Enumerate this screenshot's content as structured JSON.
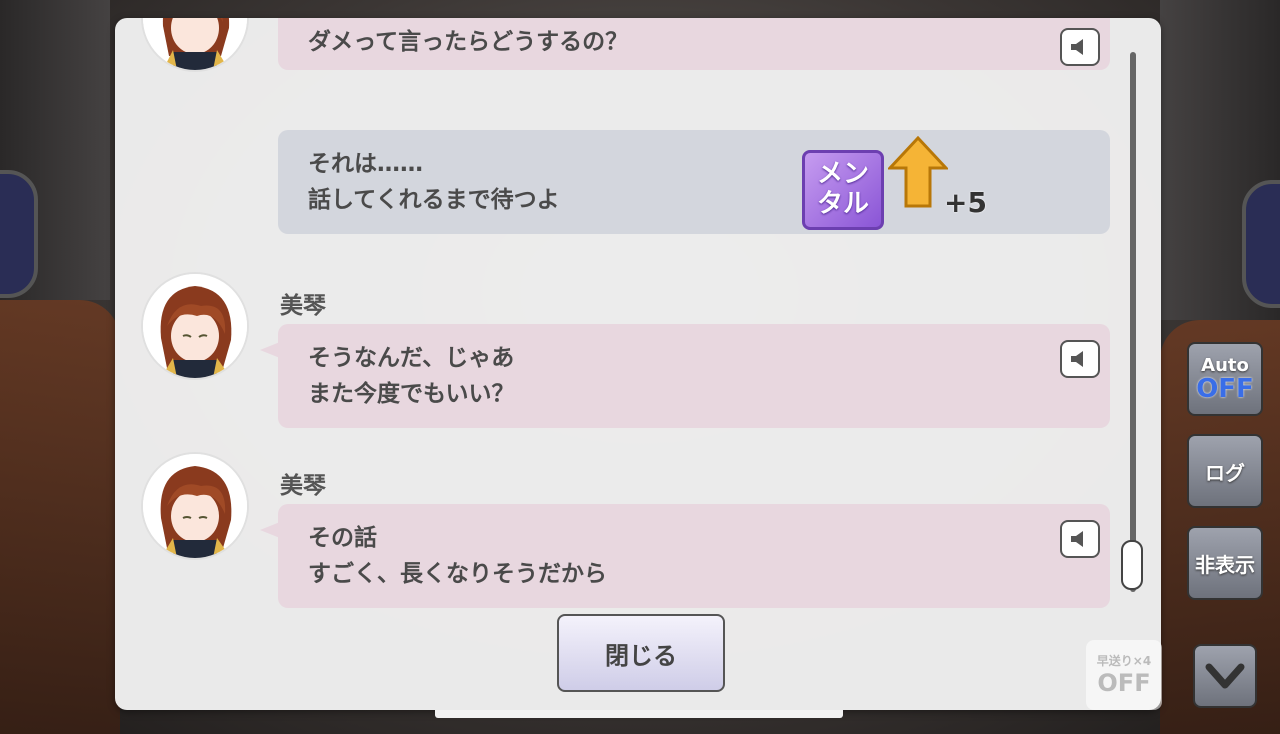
{
  "log": {
    "entries": [
      {
        "speaker": "",
        "text": "ダメって言ったらどうするの？"
      },
      {
        "choice_line1": "それは……",
        "choice_line2": "話してくれるまで待つよ"
      },
      {
        "speaker": "美琴",
        "line1": "そうなんだ、じゃあ",
        "line2": "また今度でもいい？"
      },
      {
        "speaker": "美琴",
        "line1": "その話",
        "line2": "すごく、長くなりそうだから"
      }
    ],
    "stat": {
      "name_line1": "メン",
      "name_line2": "タル",
      "value": "+5"
    }
  },
  "close_label": "閉じる",
  "side": {
    "auto_top": "Auto",
    "auto_bottom": "OFF",
    "log_label": "ログ",
    "hide_label": "非表示",
    "skip_line1": "早送り×4",
    "skip_line2": "OFF"
  },
  "colors": {
    "bubble": "#e8d7df",
    "choice": "#d3d6dd",
    "panel": "#f1f1f1",
    "accent_off": "#3a6ee8"
  },
  "icons": [
    "speaker-icon",
    "arrow-up-icon",
    "chevron-down-icon"
  ]
}
